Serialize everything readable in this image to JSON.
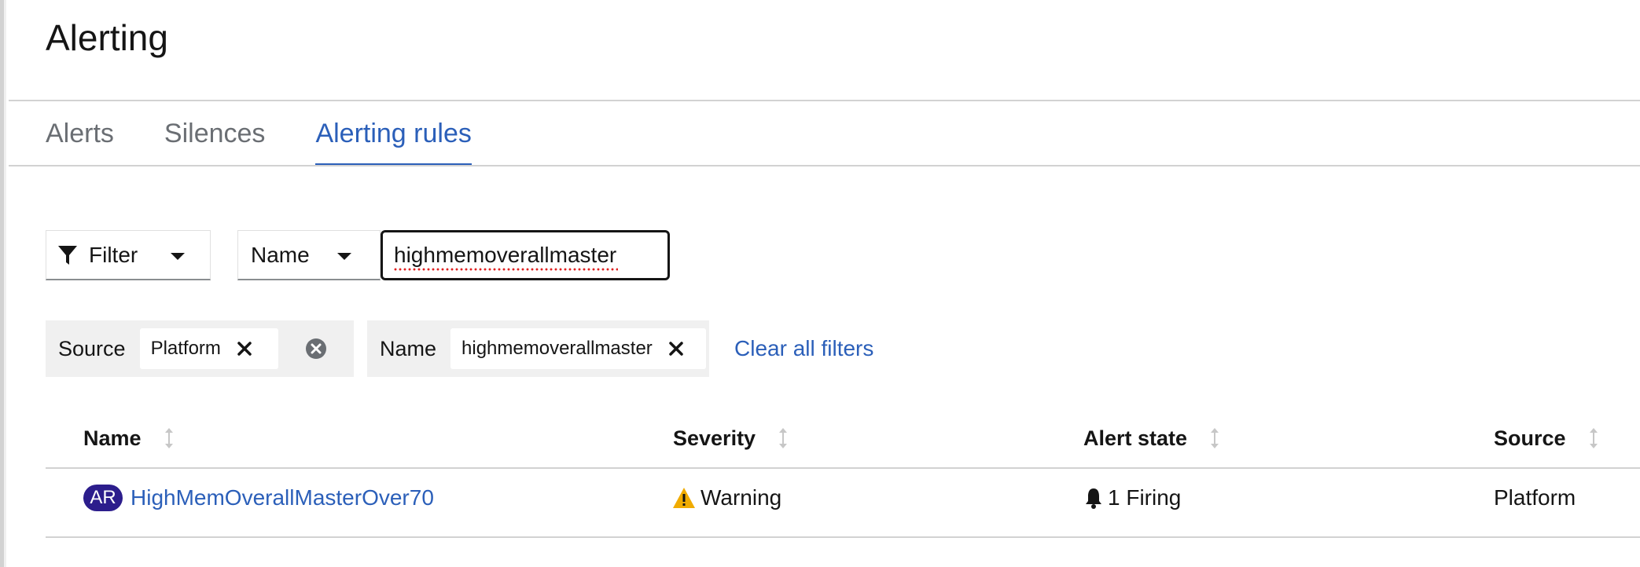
{
  "page": {
    "title": "Alerting"
  },
  "tabs": [
    {
      "label": "Alerts",
      "active": false
    },
    {
      "label": "Silences",
      "active": false
    },
    {
      "label": "Alerting rules",
      "active": true
    }
  ],
  "toolbar": {
    "filter_label": "Filter",
    "attribute_label": "Name",
    "search_value": "highmemoverallmaster"
  },
  "chips": {
    "source": {
      "category": "Source",
      "value": "Platform"
    },
    "name": {
      "category": "Name",
      "value": "highmemoverallmaster"
    },
    "clear_all": "Clear all filters"
  },
  "table": {
    "columns": [
      "Name",
      "Severity",
      "Alert state",
      "Source"
    ],
    "rows": [
      {
        "badge": "AR",
        "name": "HighMemOverallMasterOver70",
        "severity": "Warning",
        "state": "1 Firing",
        "source": "Platform"
      }
    ]
  },
  "colors": {
    "link": "#2b5fb9",
    "badge": "#2c1d8c",
    "warning": "#f0ab00"
  },
  "icons": [
    "filter-icon",
    "caret-down-icon",
    "close-icon",
    "close-circle-icon",
    "sort-icon",
    "warning-icon",
    "bell-icon"
  ]
}
